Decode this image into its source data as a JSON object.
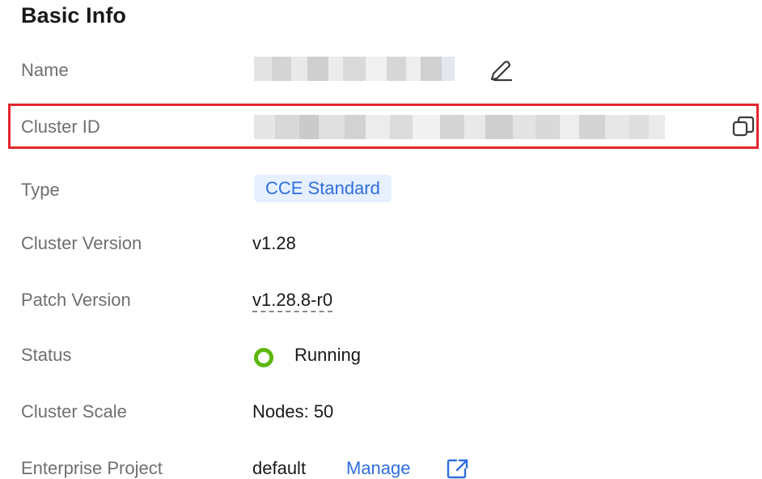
{
  "section": {
    "title": "Basic Info"
  },
  "fields": {
    "name": {
      "label": "Name"
    },
    "cluster_id": {
      "label": "Cluster ID"
    },
    "type": {
      "label": "Type",
      "value": "CCE Standard"
    },
    "cluster_version": {
      "label": "Cluster Version",
      "value": "v1.28"
    },
    "patch_version": {
      "label": "Patch Version",
      "value": "v1.28.8-r0"
    },
    "status": {
      "label": "Status",
      "value": "Running",
      "color": "#5fb70b"
    },
    "cluster_scale": {
      "label": "Cluster Scale",
      "value": "Nodes: 50"
    },
    "enterprise_project": {
      "label": "Enterprise Project",
      "value": "default",
      "link": "Manage"
    }
  },
  "icons": {
    "edit": "pencil-icon",
    "copy": "copy-icon",
    "external": "external-link-icon"
  },
  "colors": {
    "accent": "#2f6fe0",
    "highlight": "#e5262d",
    "tag_bg": "#e6f0ff"
  }
}
